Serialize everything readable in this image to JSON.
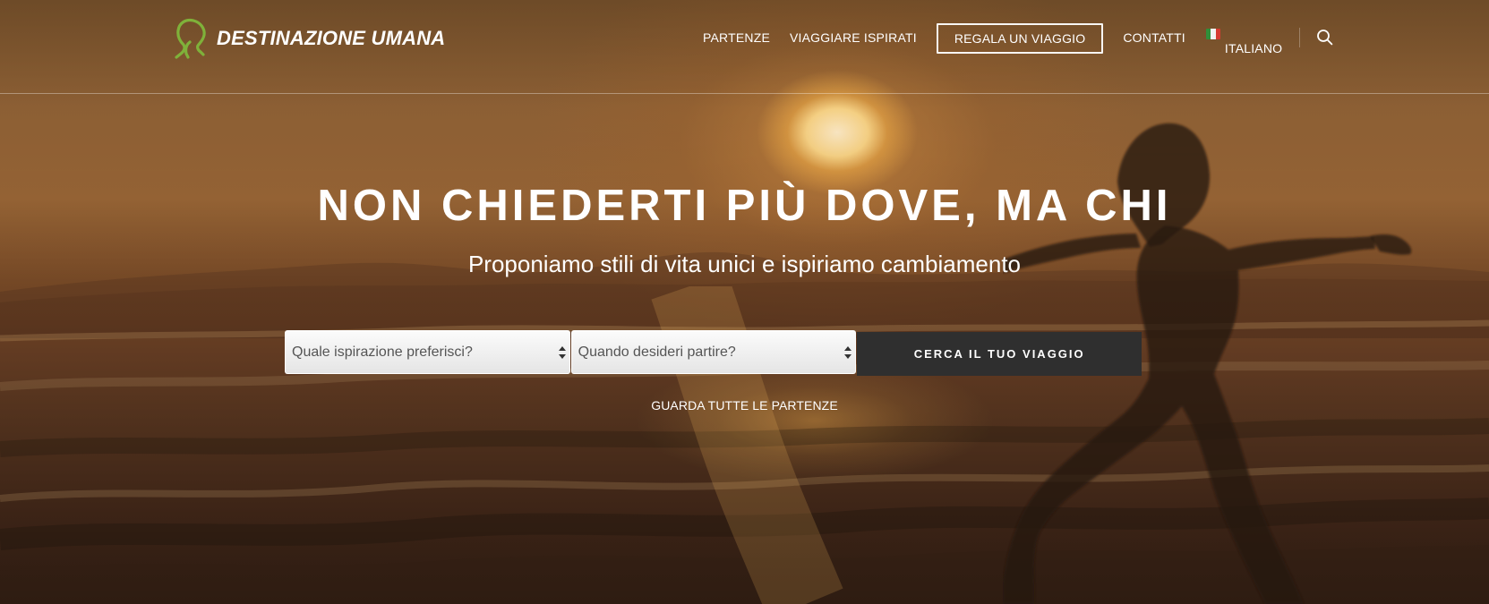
{
  "brand": {
    "name": "Destinazione Umana"
  },
  "nav": {
    "items": [
      "PARTENZE",
      "VIAGGIARE ISPIRATI",
      "REGALA UN VIAGGIO",
      "CONTATTI"
    ],
    "language_label": "ITALIANO"
  },
  "hero": {
    "headline": "NON CHIEDERTI PIÙ DOVE, MA CHI",
    "subheadline": "Proponiamo stili di vita unici e ispiriamo cambiamento"
  },
  "search": {
    "inspiration_value": "Quale ispirazione preferisci?",
    "departure_value": "Quando desideri partire?",
    "cta_label": "CERCA IL TUO VIAGGIO",
    "all_departures_label": "GUARDA TUTTE LE PARTENZE"
  },
  "colors": {
    "logo_green": "#7fb13a",
    "cta_background": "#2f2f2f",
    "header_border": "#ffffff",
    "flag_green": "#2f8f3a",
    "flag_white": "#f2f2f2",
    "flag_red": "#d63b32"
  },
  "icons": {
    "logo": "profile-logo-icon",
    "language": "italy-flag-icon",
    "search": "search-icon",
    "dropdown": "select-arrows-icon"
  }
}
